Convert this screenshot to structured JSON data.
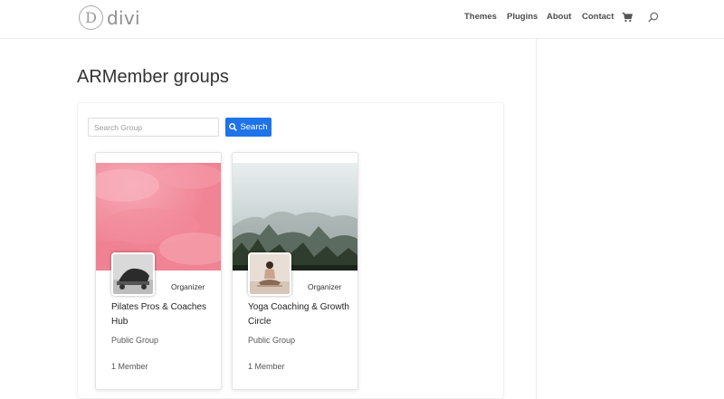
{
  "site": {
    "logo_letter": "D",
    "logo_text": "divi"
  },
  "nav": {
    "items": [
      "Themes",
      "Plugins",
      "About",
      "Contact"
    ]
  },
  "page": {
    "title": "ARMember groups"
  },
  "search": {
    "placeholder": "Search Group",
    "button_label": "Search"
  },
  "groups": [
    {
      "role": "Organizer",
      "name": "Pilates Pros & Coaches Hub",
      "type": "Public Group",
      "members": "1 Member"
    },
    {
      "role": "Organizer",
      "name": "Yoga Coaching & Growth Circle",
      "type": "Public Group",
      "members": "1 Member"
    }
  ],
  "colors": {
    "accent": "#1e73e8",
    "cover_pink": "#f08a9a",
    "cover_forest": "#2f3d2e"
  },
  "icons": {
    "cart": "cart-icon",
    "search": "search-icon"
  }
}
